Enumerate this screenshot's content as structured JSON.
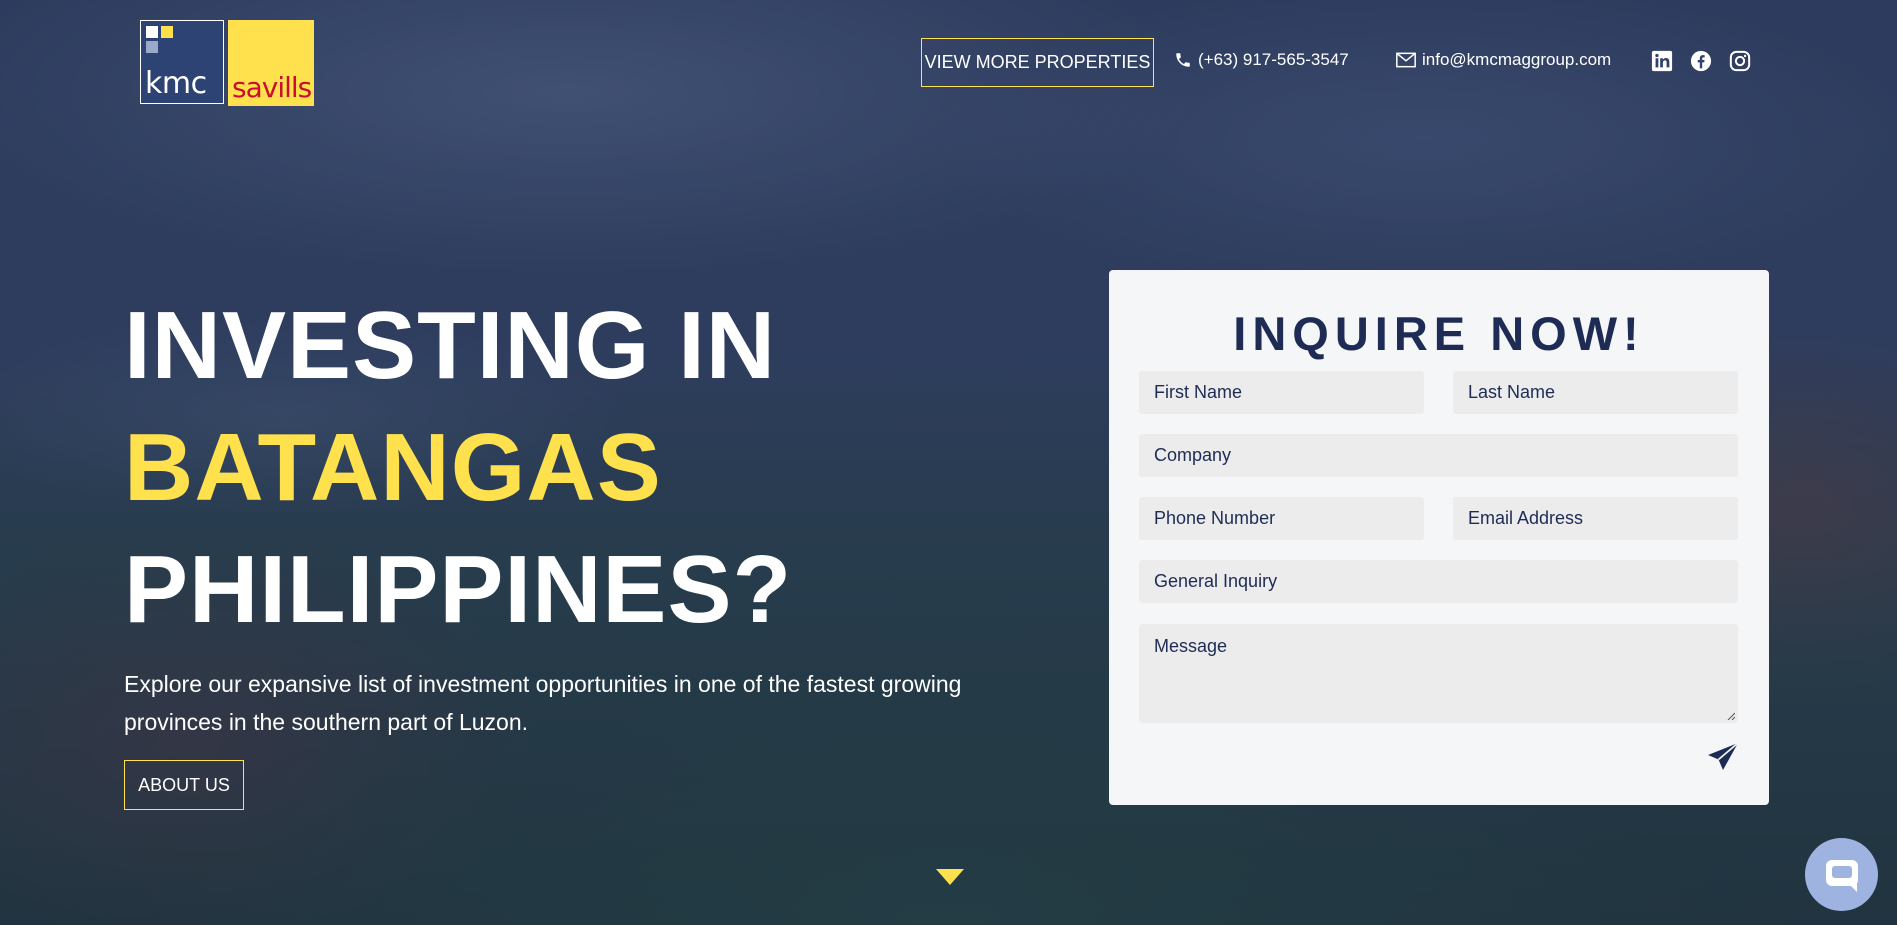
{
  "logo": {
    "left_text": "kmc",
    "right_text": "savills"
  },
  "nav": {
    "properties_button": "VIEW MORE PROPERTIES",
    "phone": "(+63) 917-565-3547",
    "email": "info@kmcmaggroup.com",
    "icons": {
      "phone": "phone-icon",
      "email": "envelope-icon",
      "social": [
        "linkedin-icon",
        "facebook-icon",
        "instagram-icon"
      ]
    }
  },
  "hero": {
    "line1": "INVESTING IN",
    "line2": "BATANGAS",
    "line3": "PHILIPPINES?",
    "description": "Explore our expansive list of investment opportunities in one of the fastest growing provinces in the southern part of Luzon.",
    "about_button": "ABOUT US"
  },
  "form": {
    "title": "INQUIRE NOW!",
    "first_name_placeholder": "First Name",
    "last_name_placeholder": "Last Name",
    "company_placeholder": "Company",
    "phone_placeholder": "Phone Number",
    "email_placeholder": "Email Address",
    "inquiry_type": "General Inquiry",
    "message_placeholder": "Message",
    "submit_icon": "send-icon"
  },
  "colors": {
    "accent": "#ffe14d",
    "navy": "#1e2c55",
    "form_bg": "#f5f6f8",
    "field_bg": "#ececec"
  }
}
